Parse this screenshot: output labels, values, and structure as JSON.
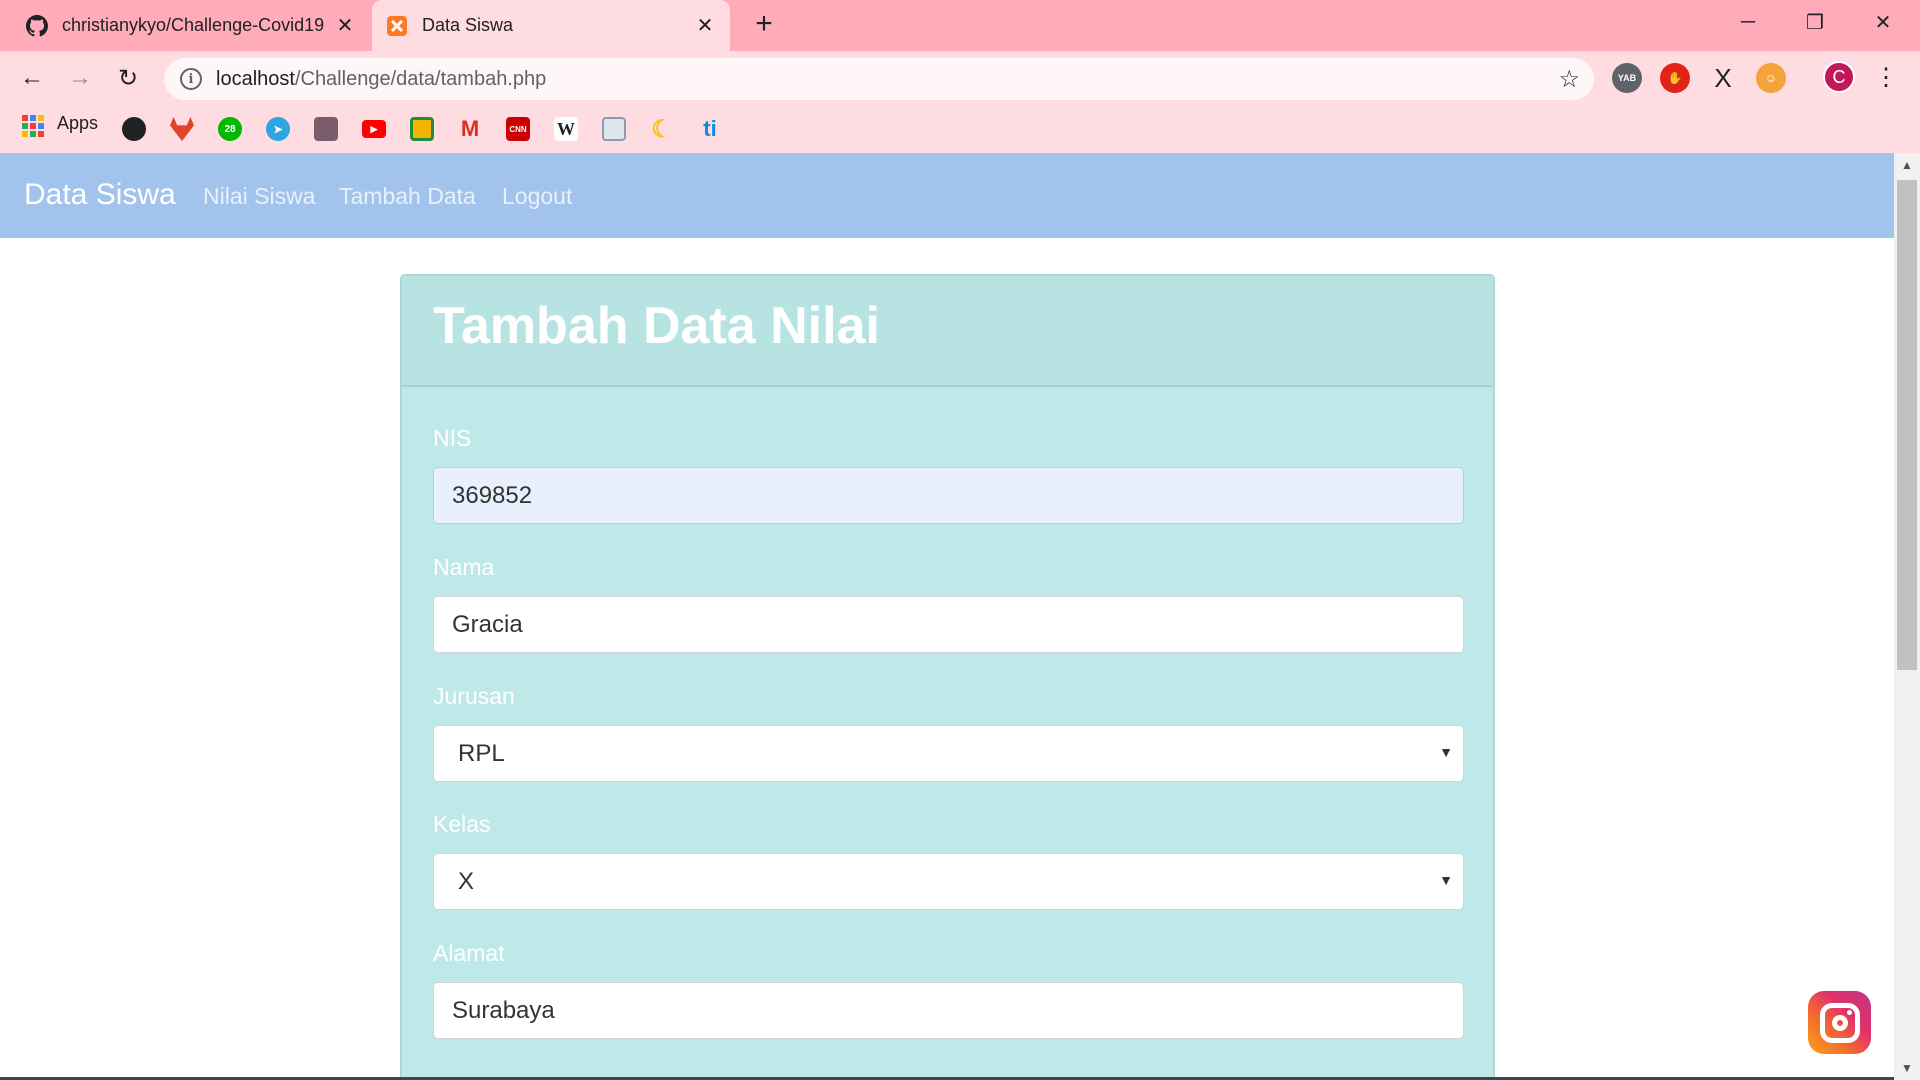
{
  "browser": {
    "tabs": [
      {
        "title": "christianykyo/Challenge-Covid19",
        "icon": "github-icon",
        "active": false
      },
      {
        "title": "Data Siswa",
        "icon": "xampp-icon",
        "active": true
      }
    ],
    "address": {
      "host": "localhost",
      "path": "/Challenge/data/tambah.php"
    },
    "profile_initial": "C",
    "apps_label": "Apps",
    "bookmarks": [
      {
        "name": "github-icon",
        "color": "#202124",
        "glyph": ""
      },
      {
        "name": "gitlab-icon",
        "color": "#e24329",
        "glyph": ""
      },
      {
        "name": "line-badge-icon",
        "color": "#00b900",
        "glyph": "28"
      },
      {
        "name": "telegram-icon",
        "color": "#2ca5e0",
        "glyph": ""
      },
      {
        "name": "photo-bookmark-icon",
        "color": "#7a5c6a",
        "glyph": ""
      },
      {
        "name": "youtube-icon",
        "color": "#ff0000",
        "glyph": "▶"
      },
      {
        "name": "google-classroom-icon",
        "color": "#f4b400",
        "glyph": ""
      },
      {
        "name": "gmail-icon",
        "color": "#ffffff",
        "glyph": "M"
      },
      {
        "name": "cnn-icon",
        "color": "#cc0000",
        "glyph": "CNN"
      },
      {
        "name": "wikipedia-icon",
        "color": "#ffffff",
        "glyph": "W"
      },
      {
        "name": "reader-icon",
        "color": "#dfe6ee",
        "glyph": ""
      },
      {
        "name": "moon-icon",
        "color": "#ffd23f",
        "glyph": "☾"
      },
      {
        "name": "ti-icon",
        "color": "#ffffff",
        "glyph": "ti"
      }
    ]
  },
  "navbar": {
    "brand": "Data Siswa",
    "links": [
      "Nilai Siswa",
      "Tambah Data",
      "Logout"
    ]
  },
  "form": {
    "title": "Tambah Data Nilai",
    "fields": [
      {
        "label": "NIS",
        "value": "369852",
        "type": "input"
      },
      {
        "label": "Nama",
        "value": "Gracia",
        "type": "input"
      },
      {
        "label": "Jurusan",
        "value": "RPL",
        "type": "select"
      },
      {
        "label": "Kelas",
        "value": "X",
        "type": "select"
      },
      {
        "label": "Alamat",
        "value": "Surabaya",
        "type": "input"
      }
    ]
  },
  "colors": {
    "tabstrip": "#ffabb9",
    "toolbar": "#ffdce2",
    "navbar": "#a2c4ec",
    "card": "#bee9e8"
  }
}
